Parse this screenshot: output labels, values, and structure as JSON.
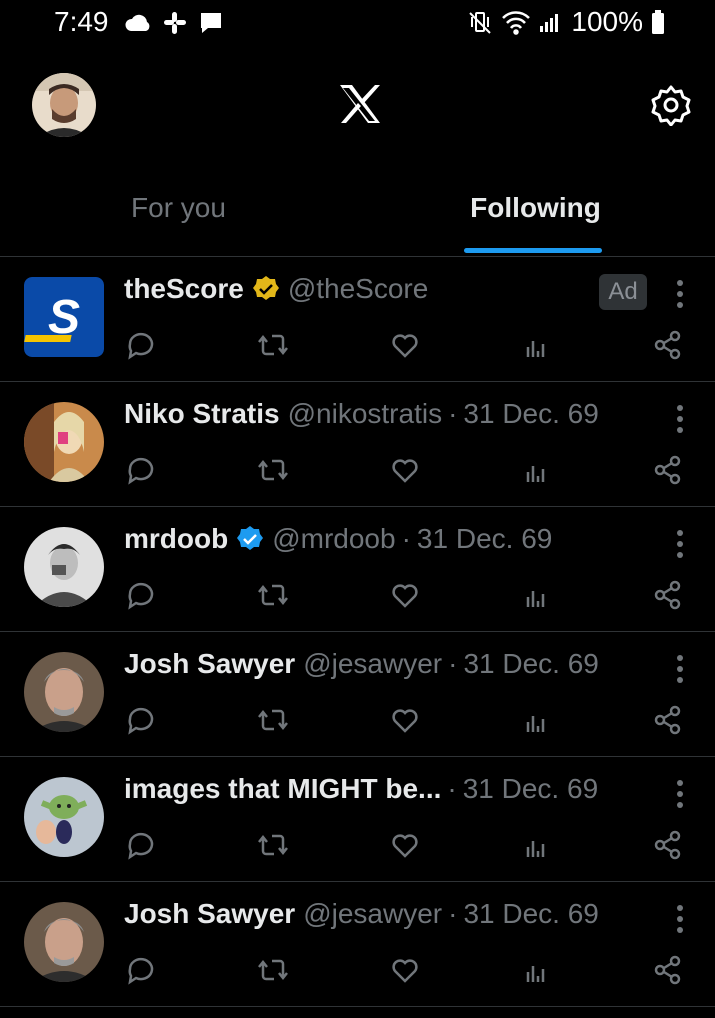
{
  "status_bar": {
    "time": "7:49",
    "battery": "100%",
    "left_icons": [
      "cloud-icon",
      "slack-icon",
      "message-icon"
    ],
    "right_icons": [
      "vibrate-icon",
      "wifi-icon",
      "signal-icon",
      "battery-icon"
    ]
  },
  "header": {
    "logo": "X"
  },
  "tabs": [
    {
      "label": "For you",
      "active": false
    },
    {
      "label": "Following",
      "active": true
    }
  ],
  "colors": {
    "accent": "#1d9bf0",
    "gold_badge": "#e2b719",
    "muted": "#71767b"
  },
  "posts": [
    {
      "name": "theScore",
      "handle": "@theScore",
      "time": "",
      "badge": "gold-verified",
      "ad": "Ad"
    },
    {
      "name": "Niko Stratis",
      "handle": "@nikostratis",
      "time": "31 Dec. 69",
      "badge": ""
    },
    {
      "name": "mrdoob",
      "handle": "@mrdoob",
      "time": "31 Dec. 69",
      "badge": "blue-verified"
    },
    {
      "name": "Josh Sawyer",
      "handle": "@jesawyer",
      "time": "31 Dec. 69",
      "badge": ""
    },
    {
      "name": "images that MIGHT be...",
      "handle": "",
      "time": "31 Dec. 69",
      "badge": ""
    },
    {
      "name": "Josh Sawyer",
      "handle": "@jesawyer",
      "time": "31 Dec. 69",
      "badge": ""
    }
  ]
}
